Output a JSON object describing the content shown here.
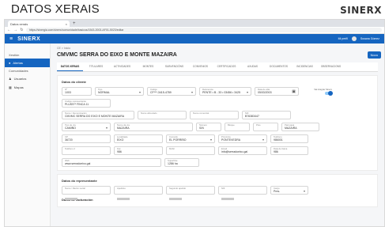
{
  "slide": {
    "title": "DATOS XERAIS",
    "logo": "SINERX"
  },
  "browser": {
    "tab_title": "Datos xerais",
    "url": "https://sinergia.com/sinerx/comunidade/basicos/1543-2003-AF01-5023/editar"
  },
  "app": {
    "brand": "SINERX",
    "user_info": "Mi perfil",
    "user_name": "Susana Gómez"
  },
  "sidebar": {
    "items": [
      {
        "label": "Xestión",
        "type": "group"
      },
      {
        "label": "Alertas",
        "type": "item",
        "active": true
      },
      {
        "label": "Comunidades",
        "type": "group"
      },
      {
        "label": "Usuarios",
        "type": "item"
      },
      {
        "label": "Mapas",
        "type": "item"
      }
    ]
  },
  "main": {
    "breadcrumb": "CE > Inicio",
    "title": "CMVMC SERRA DO EIXO E MONTE MAZAIRA",
    "add_button": "Novo"
  },
  "tabs": [
    {
      "label": "DATOS XERAIS",
      "active": true
    },
    {
      "label": "TITULARES"
    },
    {
      "label": "ACTIVIDADES"
    },
    {
      "label": "MONTES"
    },
    {
      "label": "SUBVENCIÓNS"
    },
    {
      "label": "CONVENIOS"
    },
    {
      "label": "CERTIFICADOS"
    },
    {
      "label": "AXUDAS"
    },
    {
      "label": "DOCUMENTOS"
    },
    {
      "label": "INCIDENCIAS"
    },
    {
      "label": "OBSERVACIONS"
    }
  ],
  "form": {
    "section_client": "Datos do cliente",
    "row1": [
      {
        "label": "Nº",
        "value": "1003"
      },
      {
        "label": "Tipo",
        "value": "NORMAL",
        "dropdown": true
      },
      {
        "label": "Código",
        "value": "CF***-3415-4789",
        "dropdown": true
      },
      {
        "label": "Referencia",
        "value": "PENTE • B - 33 • 03456 • 3425",
        "dropdown": true
      },
      {
        "label": "Data de alta",
        "value": "05/03/2003",
        "calendar": true
      }
    ],
    "toggle_label": "Vai integrar Sinerx",
    "row2": [
      {
        "label": "Código representante",
        "value": "PLUSS** FINCA 11"
      }
    ],
    "row3": [
      {
        "label": "Nome / Denominación",
        "value": "CMVMC SERRA DO EIXO E MONTE MAZAIRA"
      },
      {
        "label": "Nome abreviado",
        "value": ""
      },
      {
        "label": "Nome comercial",
        "value": ""
      },
      {
        "label": "NIF",
        "value": "B76383447"
      }
    ],
    "row4": [
      {
        "label": "Tipo de vía",
        "value": "CAMIÑO",
        "dropdown": true
      },
      {
        "label": "Nome da vía",
        "value": "MAZAIRA"
      },
      {
        "label": "Número",
        "value": "S/N"
      },
      {
        "label": "Bloque",
        "value": ""
      },
      {
        "label": "Piso",
        "value": ""
      },
      {
        "label": "Parroquia",
        "value": "MAZAIRA"
      }
    ],
    "row5": [
      {
        "label": "CP",
        "value": "36720"
      },
      {
        "label": "Localidade",
        "value": "EIXO"
      },
      {
        "label": "Concello",
        "value": "EL PORRIÑO",
        "dropdown": true
      },
      {
        "label": "Provincia",
        "value": "PONTEVEDRA",
        "dropdown": true
      },
      {
        "label": "Teléfono",
        "value": "986001"
      }
    ],
    "row6": [
      {
        "label": "Teléfono 2",
        "value": "",
        "grey": true
      },
      {
        "label": "Fax",
        "value": "986"
      },
      {
        "label": "Móbil",
        "value": "",
        "grey": true
      },
      {
        "label": "Email",
        "value": "info@serradoeixo.gal"
      },
      {
        "label": "Data de baixa",
        "value": "986"
      }
    ],
    "row7": [
      {
        "label": "Web",
        "value": "www.serradoeixo.gal"
      },
      {
        "label": "Superficie",
        "value": "1286 ha"
      }
    ],
    "section_rep": "Datos do representante",
    "row8": [
      {
        "label": "Nome / Razón social",
        "value": "",
        "grey": true
      },
      {
        "label": "Apelidos",
        "value": "",
        "grey": true
      },
      {
        "label": "Segundo apelido",
        "value": "",
        "grey": true
      },
      {
        "label": "NIF",
        "value": "",
        "grey": true
      },
      {
        "label": "Cargo",
        "value": "Pres.",
        "dropdown": true
      }
    ],
    "section_bank": "Datos de facturación"
  }
}
